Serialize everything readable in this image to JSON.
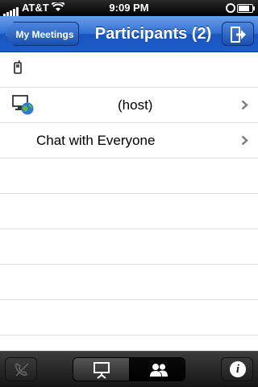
{
  "status_bar": {
    "carrier": "AT&T",
    "time": "9:09 PM",
    "battery_level": 0.8
  },
  "nav": {
    "back_label": "My Meetings",
    "title": "Participants (2)",
    "exit_icon": "exit-icon"
  },
  "rows": [
    {
      "icon": "mobile-phone-icon",
      "label": "",
      "chevron": false
    },
    {
      "icon": "computer-globe-icon",
      "label": "(host)",
      "chevron": true
    },
    {
      "icon": "",
      "label": "Chat with Everyone",
      "chevron": true
    },
    {
      "icon": "",
      "label": "",
      "chevron": false
    },
    {
      "icon": "",
      "label": "",
      "chevron": false
    },
    {
      "icon": "",
      "label": "",
      "chevron": false
    },
    {
      "icon": "",
      "label": "",
      "chevron": false
    },
    {
      "icon": "",
      "label": "",
      "chevron": false
    }
  ],
  "tab_bar": {
    "phone_icon": "phone-disabled-icon",
    "segments": [
      {
        "icon": "presentation-icon",
        "selected": false
      },
      {
        "icon": "participants-icon",
        "selected": true
      }
    ],
    "info_label": "i"
  },
  "colors": {
    "nav_blue": "#2f6fd4",
    "tab_dark": "#1a1a1a"
  }
}
